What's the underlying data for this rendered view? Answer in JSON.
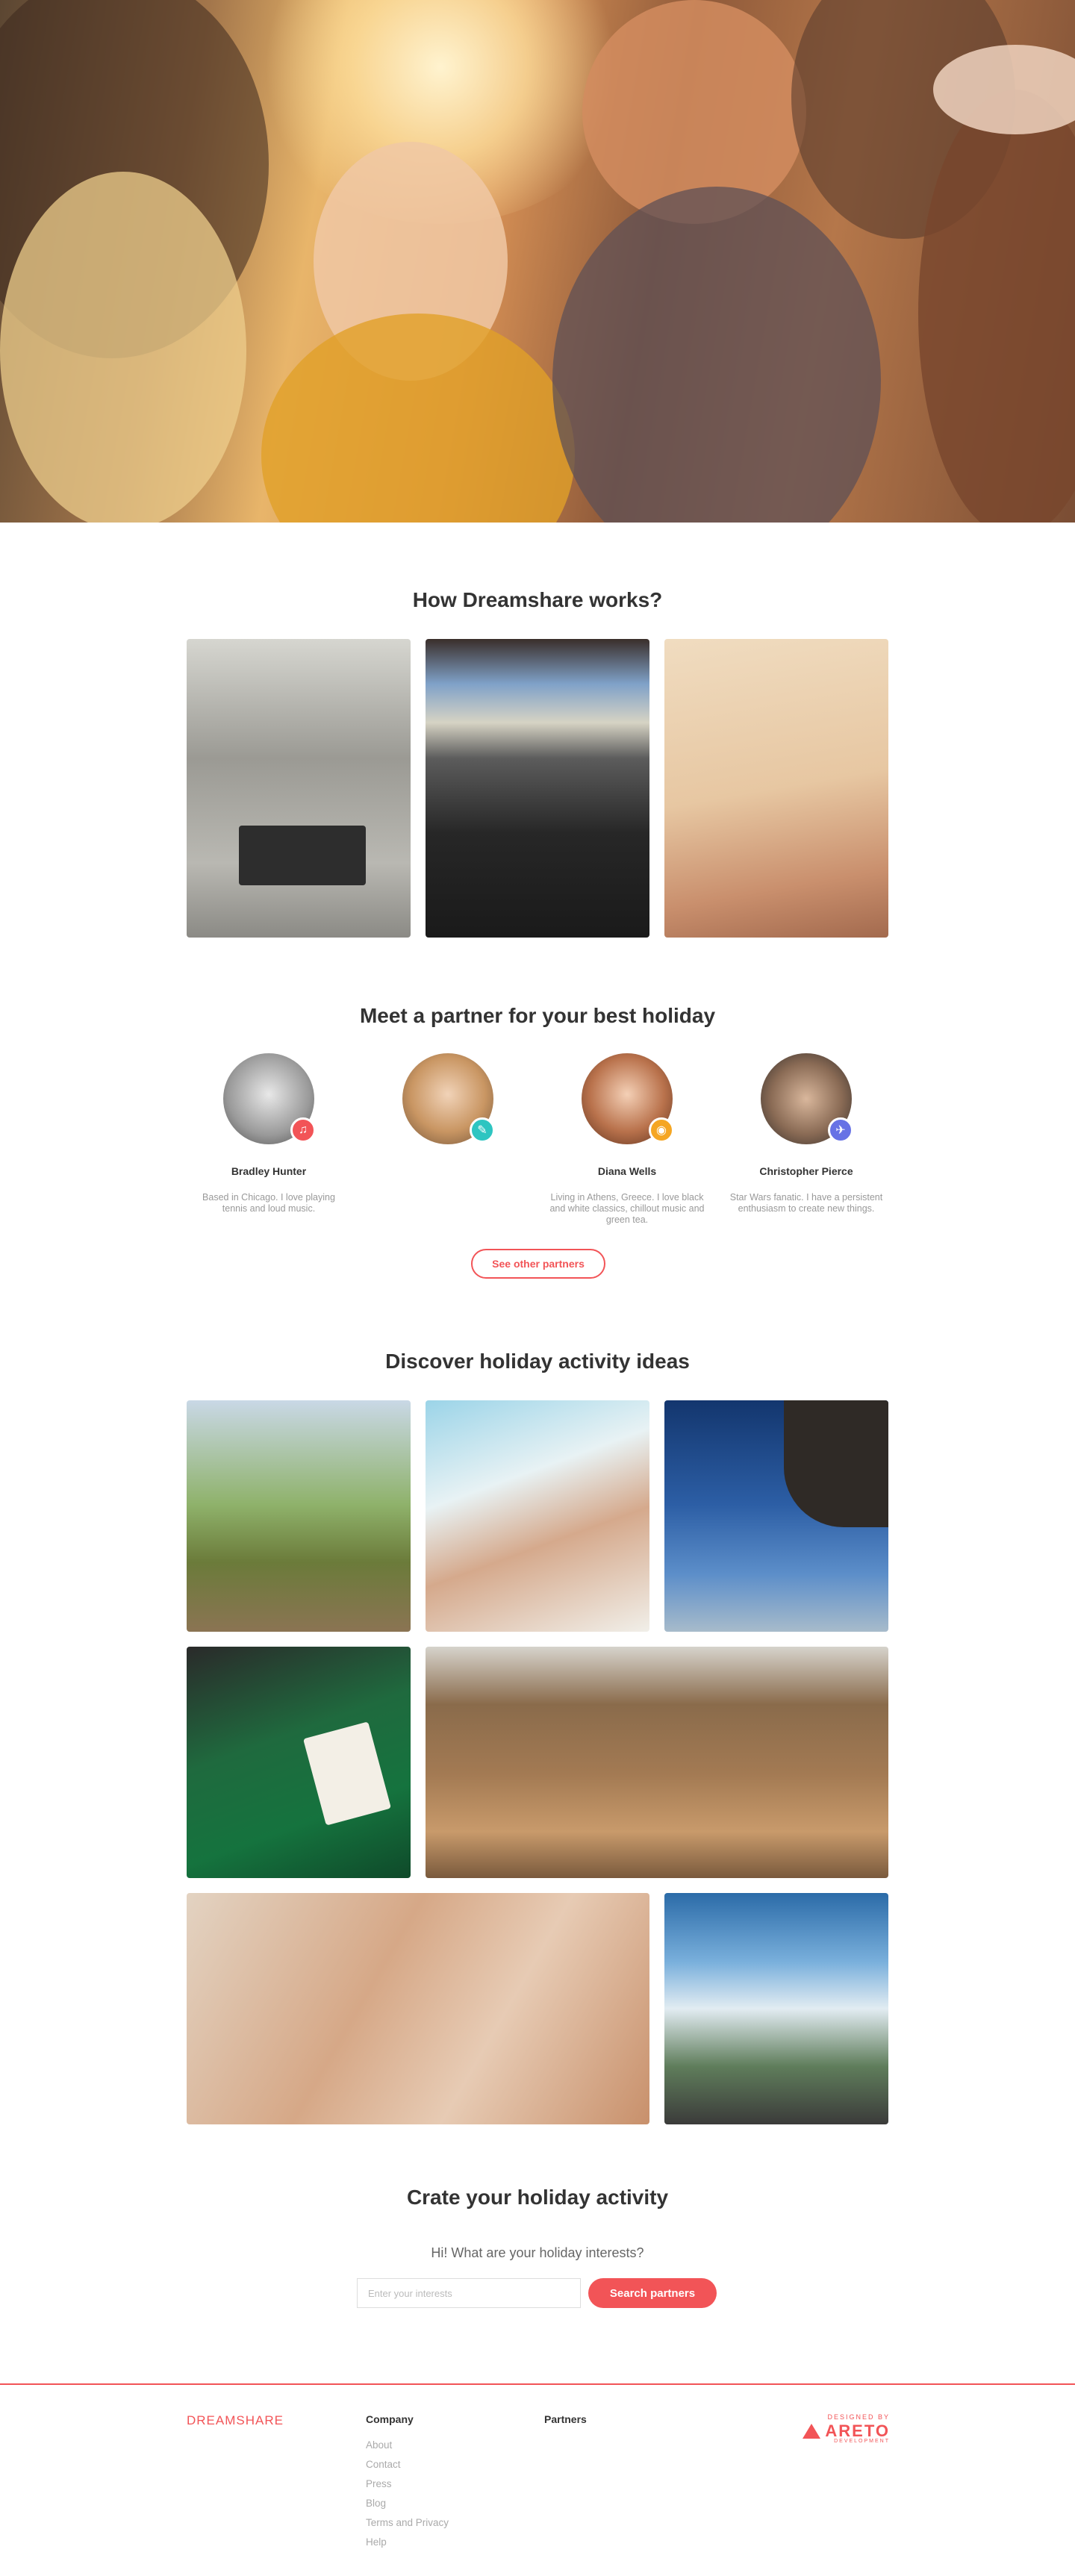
{
  "sections": {
    "how": {
      "title": "How Dreamshare works?"
    },
    "partners": {
      "title": "Meet a partner for your best holiday"
    },
    "ideas": {
      "title": "Discover holiday activity ideas"
    },
    "create": {
      "title": "Crate your holiday activity"
    }
  },
  "partners": [
    {
      "name": "Bradley Hunter",
      "bio": "Based in Chicago. I love playing tennis and loud music.",
      "badge_icon": "music-icon",
      "badge_color": "#f25457"
    },
    {
      "name": "",
      "bio": "",
      "badge_icon": "pencil-icon",
      "badge_color": "#2ec5c1"
    },
    {
      "name": "Diana Wells",
      "bio": "Living in Athens, Greece. I love black and white classics, chillout music and green tea.",
      "badge_icon": "camera-icon",
      "badge_color": "#f5a623"
    },
    {
      "name": "Christopher Pierce",
      "bio": "Star Wars fanatic. I have a persistent enthusiasm to create new things.",
      "badge_icon": "plane-icon",
      "badge_color": "#6772e5"
    }
  ],
  "see_other_partners": "See other partners",
  "form": {
    "question": "Hi! What are your holiday interests?",
    "placeholder": "Enter your interests",
    "button": "Search partners"
  },
  "footer": {
    "brand": "DREAMSHARE",
    "company": {
      "title": "Company",
      "links": [
        "About",
        "Contact",
        "Press",
        "Blog",
        "Terms and Privacy",
        "Help"
      ]
    },
    "partners": {
      "title": "Partners"
    },
    "designed_by": "DESIGNED BY",
    "designer_name": "ARETO",
    "designer_sub": "DEVELOPMENT"
  },
  "colors": {
    "accent": "#f25457"
  }
}
